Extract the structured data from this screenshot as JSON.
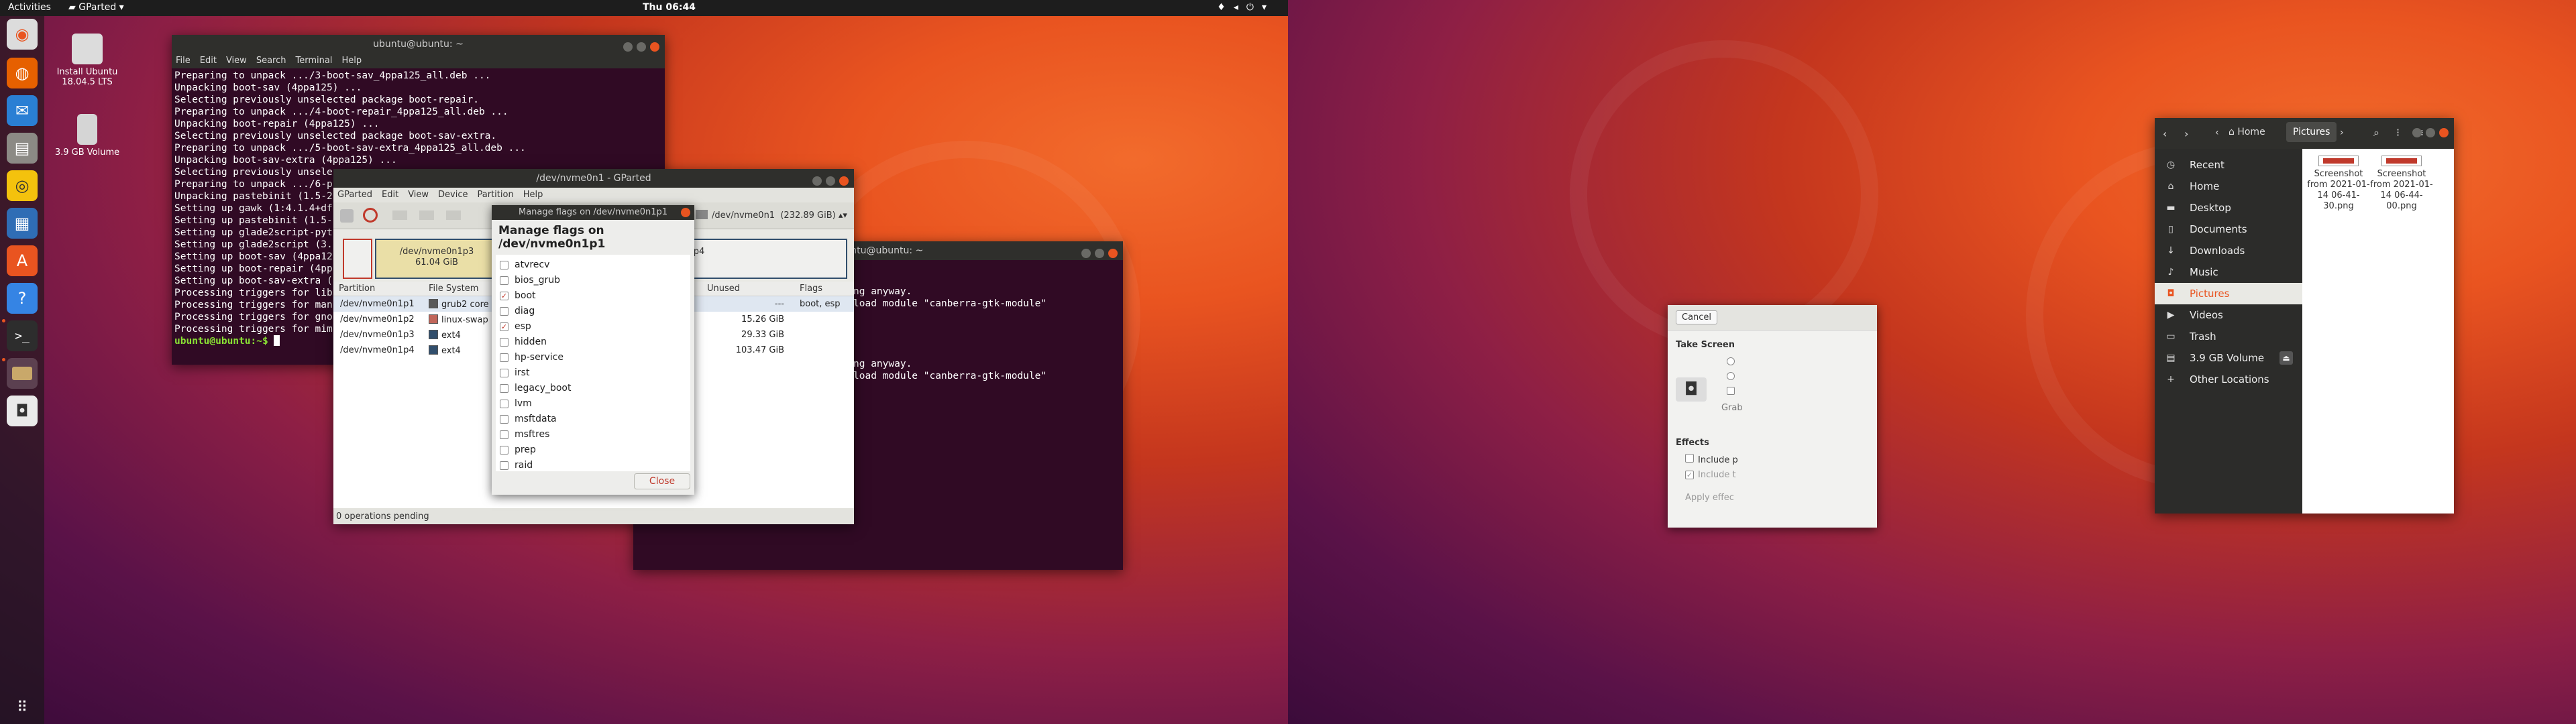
{
  "screen1": {
    "topbar": {
      "activities": "Activities",
      "app_menu": "GParted",
      "clock": "Thu 06:44"
    },
    "dock": {
      "items": [
        {
          "icon": "ubuntu-installer-icon"
        },
        {
          "icon": "firefox-icon"
        },
        {
          "icon": "thunderbird-icon"
        },
        {
          "icon": "files-icon"
        },
        {
          "icon": "rhythmbox-icon"
        },
        {
          "icon": "writer-icon"
        },
        {
          "icon": "software-icon"
        },
        {
          "icon": "help-icon"
        },
        {
          "icon": "terminal-icon"
        },
        {
          "icon": "gparted-icon"
        },
        {
          "icon": "screenshot-icon"
        }
      ],
      "apps_grid_icon": "apps-grid-icon"
    },
    "desktop_icons": {
      "install": "Install Ubuntu 18.04.5 LTS",
      "volume": "3.9 GB Volume"
    },
    "terminal1": {
      "title": "ubuntu@ubuntu: ~",
      "menu": [
        "File",
        "Edit",
        "View",
        "Search",
        "Terminal",
        "Help"
      ],
      "lines": [
        "Preparing to unpack .../3-boot-sav_4ppa125_all.deb ...",
        "Unpacking boot-sav (4ppa125) ...",
        "Selecting previously unselected package boot-repair.",
        "Preparing to unpack .../4-boot-repair_4ppa125_all.deb ...",
        "Unpacking boot-repair (4ppa125) ...",
        "Selecting previously unselected package boot-sav-extra.",
        "Preparing to unpack .../5-boot-sav-extra_4ppa125_all.deb ...",
        "Unpacking boot-sav-extra (4ppa125) ...",
        "Selecting previously unsele",
        "Preparing to unpack .../6-p",
        "Unpacking pastebinit (1.5-2",
        "Setting up gawk (1:4.1.4+df",
        "Setting up pastebinit (1.5-",
        "Setting up glade2script-pyt",
        "Setting up glade2script (3.",
        "Setting up boot-sav (4ppa12",
        "Setting up boot-repair (4pp",
        "Setting up boot-sav-extra (",
        "Processing triggers for lib",
        "Processing triggers for man",
        "Processing triggers for gno",
        "Processing triggers for mim"
      ],
      "prompt": "ubuntu@ubuntu:~$ "
    },
    "terminal2": {
      "title": "ubuntu@ubuntu: ~",
      "lines": [
        "",
        "",
        "ng anyway.",
        "load module \"canberra-gtk-module\"",
        "",
        "",
        "",
        "",
        "ng anyway.",
        "load module \"canberra-gtk-module\""
      ]
    },
    "gparted": {
      "title": "/dev/nvme0n1 - GParted",
      "menu": [
        "GParted",
        "Edit",
        "View",
        "Device",
        "Partition",
        "Help"
      ],
      "device": "/dev/nvme0n1",
      "device_size": "(232.89 GiB)",
      "bar": {
        "p3_name": "/dev/nvme0n1p3",
        "p3_size": "61.04 GiB",
        "p4_name": "0n1p4"
      },
      "headers": {
        "partition": "Partition",
        "fs": "File System",
        "unused": "Unused",
        "flags": "Flags"
      },
      "rows": [
        {
          "partition": "/dev/nvme0n1p1",
          "fs": "grub2 core",
          "fs_color": "#595959",
          "unused": "---",
          "flags": "boot, esp"
        },
        {
          "partition": "/dev/nvme0n1p2",
          "fs": "linux-swap",
          "fs_color": "#c1665a",
          "unused": "15.26 GiB",
          "flags": ""
        },
        {
          "partition": "/dev/nvme0n1p3",
          "fs": "ext4",
          "fs_color": "#314e6c",
          "unused": "29.33 GiB",
          "flags": ""
        },
        {
          "partition": "/dev/nvme0n1p4",
          "fs": "ext4",
          "fs_color": "#314e6c",
          "unused": "103.47 GiB",
          "flags": ""
        }
      ],
      "status": "0 operations pending"
    },
    "flags_dialog": {
      "title": "Manage flags on /dev/nvme0n1p1",
      "heading": "Manage flags on /dev/nvme0n1p1",
      "flags": [
        {
          "name": "atvrecv",
          "checked": false
        },
        {
          "name": "bios_grub",
          "checked": false
        },
        {
          "name": "boot",
          "checked": true
        },
        {
          "name": "diag",
          "checked": false
        },
        {
          "name": "esp",
          "checked": true
        },
        {
          "name": "hidden",
          "checked": false
        },
        {
          "name": "hp-service",
          "checked": false
        },
        {
          "name": "irst",
          "checked": false
        },
        {
          "name": "legacy_boot",
          "checked": false
        },
        {
          "name": "lvm",
          "checked": false
        },
        {
          "name": "msftdata",
          "checked": false
        },
        {
          "name": "msftres",
          "checked": false
        },
        {
          "name": "prep",
          "checked": false
        },
        {
          "name": "raid",
          "checked": false
        }
      ],
      "close": "Close"
    }
  },
  "screen2": {
    "screenshot_dialog": {
      "cancel": "Cancel",
      "take": "Take Screen",
      "grab": "Grab",
      "effects": "Effects",
      "include1": "Include p",
      "include2": "Include t",
      "apply": "Apply effec"
    },
    "files": {
      "path_home": "Home",
      "path_current": "Pictures",
      "sidebar": [
        {
          "label": "Recent",
          "icon": "clock-icon"
        },
        {
          "label": "Home",
          "icon": "home-icon"
        },
        {
          "label": "Desktop",
          "icon": "folder-icon"
        },
        {
          "label": "Documents",
          "icon": "document-icon"
        },
        {
          "label": "Downloads",
          "icon": "download-icon"
        },
        {
          "label": "Music",
          "icon": "music-icon"
        },
        {
          "label": "Pictures",
          "icon": "camera-icon"
        },
        {
          "label": "Videos",
          "icon": "video-icon"
        },
        {
          "label": "Trash",
          "icon": "trash-icon"
        },
        {
          "label": "3.9 GB Volume",
          "icon": "drive-icon"
        },
        {
          "label": "Other Locations",
          "icon": "plus-icon"
        }
      ],
      "files": [
        {
          "name": "Screenshot from 2021-01-14 06-41-30.png"
        },
        {
          "name": "Screenshot from 2021-01-14 06-44-00.png"
        }
      ]
    }
  }
}
